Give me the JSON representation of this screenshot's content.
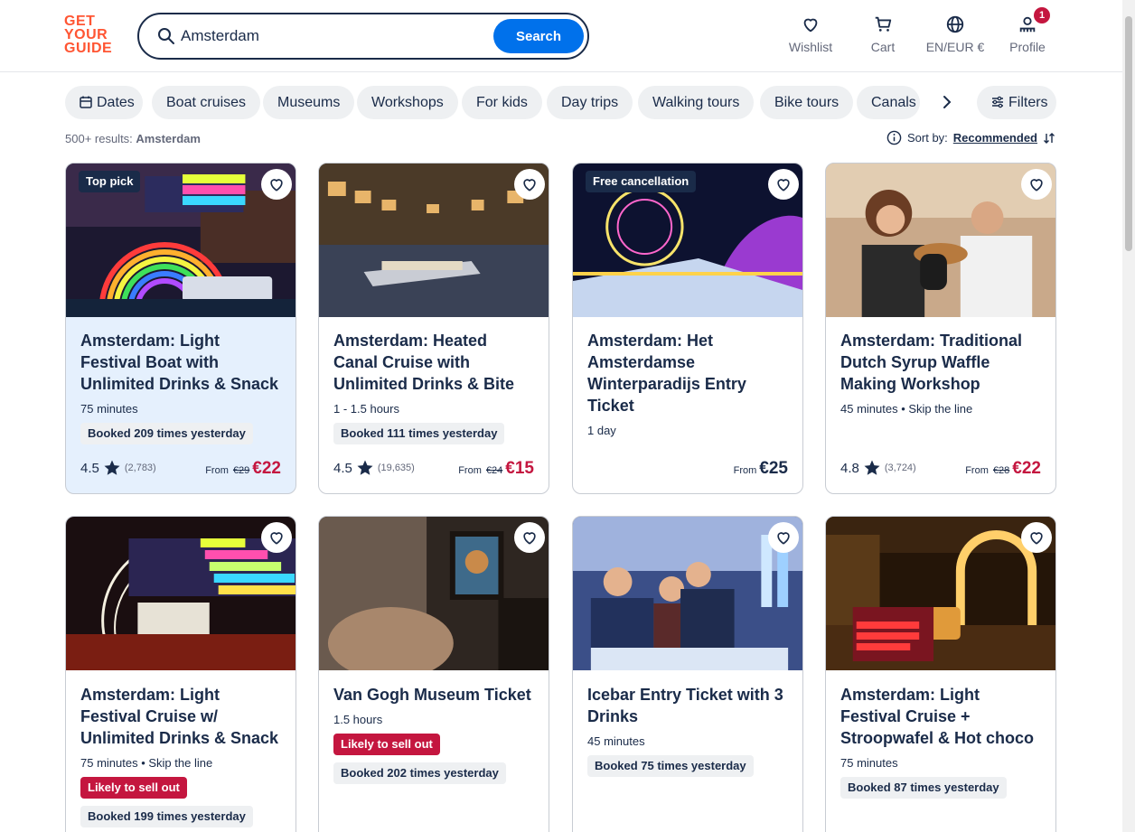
{
  "header": {
    "logo_lines": [
      "GET",
      "YOUR",
      "GUIDE"
    ],
    "search_value": "Amsterdam",
    "search_button": "Search",
    "nav": {
      "wishlist": "Wishlist",
      "cart": "Cart",
      "language": "EN/EUR €",
      "profile": "Profile",
      "profile_badge": "1"
    }
  },
  "filters": {
    "chips": [
      "Dates",
      "Boat cruises",
      "Museums",
      "Workshops",
      "For kids",
      "Day trips",
      "Walking tours",
      "Bike tours",
      "Canals"
    ],
    "filters_label": "Filters"
  },
  "results": {
    "count": "500+ results:",
    "query": "Amsterdam",
    "sort_label": "Sort by:",
    "sort_value": "Recommended"
  },
  "cards": [
    {
      "badge": "Top pick",
      "title": "Amsterdam: Light Festival Boat with Unlimited Drinks & Snack",
      "meta": "75 minutes",
      "sellout": "",
      "booked": "Booked 209 times yesterday",
      "rating": "4.5",
      "reviews": "(2,783)",
      "from": "From",
      "old_price": "€29",
      "price": "€22"
    },
    {
      "badge": "",
      "title": "Amsterdam: Heated Canal Cruise with Unlimited Drinks & Bite",
      "meta": "1 - 1.5 hours",
      "sellout": "",
      "booked": "Booked 111 times yesterday",
      "rating": "4.5",
      "reviews": "(19,635)",
      "from": "From",
      "old_price": "€24",
      "price": "€15"
    },
    {
      "badge": "Free cancellation",
      "title": "Amsterdam: Het Amsterdamse Winterparadijs Entry Ticket",
      "meta": "1 day",
      "sellout": "",
      "booked": "",
      "rating": "",
      "reviews": "",
      "from": "From",
      "old_price": "",
      "price": "€25"
    },
    {
      "badge": "",
      "title": "Amsterdam: Traditional Dutch Syrup Waffle Making Workshop",
      "meta": "45 minutes • Skip the line",
      "sellout": "",
      "booked": "",
      "rating": "4.8",
      "reviews": "(3,724)",
      "from": "From",
      "old_price": "€28",
      "price": "€22"
    },
    {
      "badge": "",
      "title": "Amsterdam: Light Festival Cruise w/ Unlimited Drinks & Snack",
      "meta": "75 minutes • Skip the line",
      "sellout": "Likely to sell out",
      "booked": "Booked 199 times yesterday",
      "rating": "",
      "reviews": "",
      "from": "",
      "old_price": "",
      "price": ""
    },
    {
      "badge": "",
      "title": "Van Gogh Museum Ticket",
      "meta": "1.5 hours",
      "sellout": "Likely to sell out",
      "booked": "Booked 202 times yesterday",
      "rating": "",
      "reviews": "",
      "from": "",
      "old_price": "",
      "price": ""
    },
    {
      "badge": "",
      "title": "Icebar Entry Ticket with 3 Drinks",
      "meta": "45 minutes",
      "sellout": "",
      "booked": "Booked 75 times yesterday",
      "rating": "",
      "reviews": "",
      "from": "",
      "old_price": "",
      "price": ""
    },
    {
      "badge": "",
      "title": "Amsterdam: Light Festival Cruise + Stroopwafel & Hot choco",
      "meta": "75 minutes",
      "sellout": "",
      "booked": "Booked 87 times yesterday",
      "rating": "",
      "reviews": "",
      "from": "",
      "old_price": "",
      "price": ""
    }
  ],
  "colors": {
    "brand": "#ff5533",
    "primary_button": "#0071eb",
    "navy_text": "#1a2b49",
    "sale_red": "#c4163f",
    "highlight_card": "#e5f0fd"
  },
  "icons": [
    "search-icon",
    "heart-icon",
    "cart-icon",
    "globe-icon",
    "profile-icon",
    "calendar-icon",
    "chevron-right-icon",
    "filters-icon",
    "info-icon",
    "sort-icon",
    "star-icon"
  ]
}
